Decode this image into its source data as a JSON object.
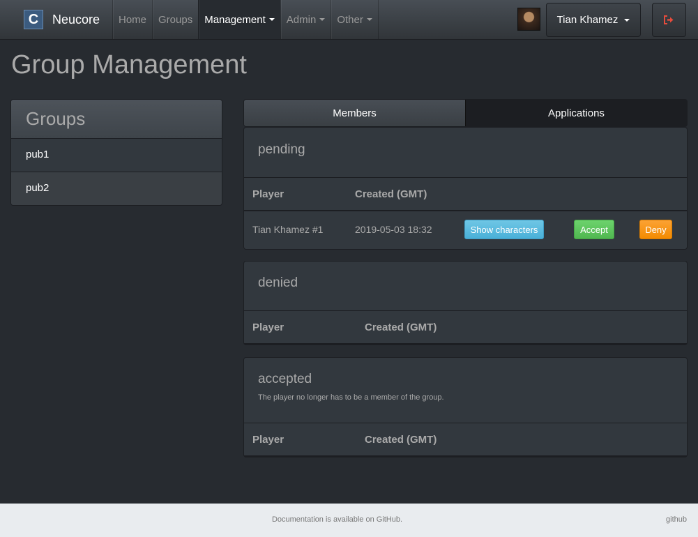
{
  "navbar": {
    "brand_letter": "C",
    "brand": "Neucore",
    "items": [
      {
        "label": "Home"
      },
      {
        "label": "Groups"
      },
      {
        "label": "Management"
      },
      {
        "label": "Admin"
      },
      {
        "label": "Other"
      }
    ],
    "user": "Tian Khamez",
    "logout_icon": "sign-out-icon",
    "accent": "#e74c3c"
  },
  "page_title": "Group Management",
  "groups": {
    "title": "Groups",
    "items": [
      {
        "label": "pub1"
      },
      {
        "label": "pub2"
      }
    ]
  },
  "tabs": [
    {
      "label": "Members"
    },
    {
      "label": "Applications"
    }
  ],
  "pending": {
    "title": "pending",
    "columns": [
      "Player",
      "Created (GMT)"
    ],
    "rows": [
      {
        "player": "Tian Khamez #1",
        "created": "2019-05-03 18:32",
        "show": "Show characters",
        "accept": "Accept",
        "deny": "Deny"
      }
    ]
  },
  "denied": {
    "title": "denied",
    "columns": [
      "Player",
      "Created (GMT)"
    ]
  },
  "accepted": {
    "title": "accepted",
    "note": "The player no longer has to be a member of the group.",
    "columns": [
      "Player",
      "Created (GMT)"
    ]
  },
  "footer": {
    "text": "Documentation is available on GitHub.",
    "link": "github"
  }
}
